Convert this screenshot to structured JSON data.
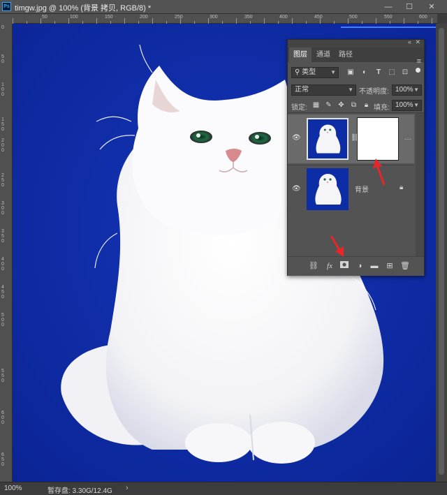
{
  "title_bar": {
    "app_icon": "Ps",
    "document_title": "timgw.jpg @ 100% (背景 拷贝, RGB/8) *",
    "minimize": "—",
    "maximize": "☐",
    "close": "✕"
  },
  "rulers": {
    "top_ticks": [
      "50",
      "100",
      "150",
      "200",
      "250",
      "300",
      "350",
      "400",
      "450",
      "500",
      "550",
      "600"
    ],
    "left_ticks": [
      "0",
      "5 0",
      "1 0 0",
      "1 5 0",
      "2 0 0",
      "2 5 0",
      "3 0 0",
      "3 5 0",
      "4 0 0",
      "4 5 0",
      "5 0 0",
      "5 5 0",
      "6 0 0",
      "6 5 0"
    ]
  },
  "layers_panel": {
    "collapse": "«",
    "close": "✕",
    "tabs": [
      "图层",
      "通道",
      "路径"
    ],
    "active_tab": "图层",
    "menu_icon": "≡",
    "filter": {
      "value": "类型",
      "icons": [
        "image-filter-icon",
        "adjustment-filter-icon",
        "type-filter-icon",
        "shape-filter-icon",
        "smart-object-filter-icon"
      ]
    },
    "blend_mode": "正常",
    "opacity_label": "不透明度:",
    "opacity_value": "100%",
    "lock_label": "锁定:",
    "lock_icons": [
      "lock-transparent-icon",
      "lock-paint-icon",
      "lock-position-icon",
      "lock-artboard-icon",
      "lock-all-icon"
    ],
    "fill_label": "填充:",
    "fill_value": "100%",
    "layers": [
      {
        "name": "",
        "visible": true,
        "selected": true,
        "has_mask": true,
        "mask_color": "#ffffff"
      },
      {
        "name": "背景",
        "visible": true,
        "selected": false,
        "locked": true
      }
    ],
    "bottom_icons": [
      "link-layers-icon",
      "fx-icon",
      "add-mask-icon",
      "adjustment-layer-icon",
      "group-folder-icon",
      "new-layer-icon",
      "trash-icon"
    ],
    "fx_label": "fx"
  },
  "status_bar": {
    "zoom": "100%",
    "scratch_disk": "暂存盘: 3.30G/12.4G",
    "more": "›"
  },
  "colors": {
    "canvas_background": "#0d2da6",
    "panel": "#535353",
    "annotation_arrow": "#e8262a"
  }
}
